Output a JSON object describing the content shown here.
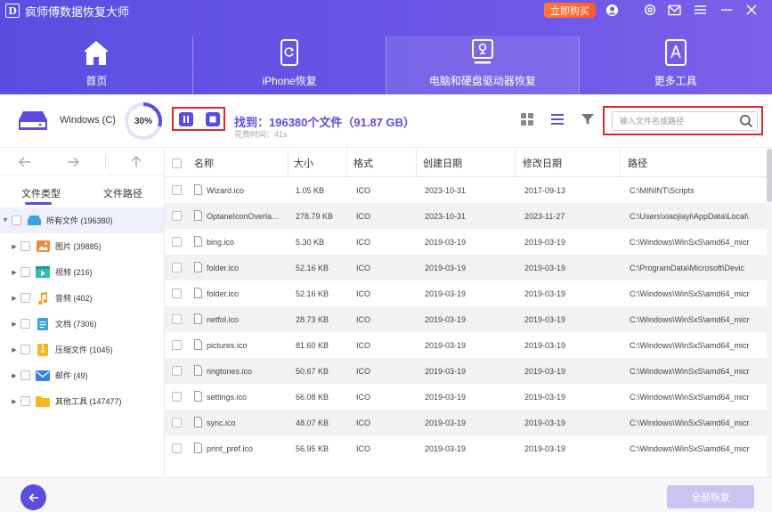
{
  "app": {
    "title": "疯师傅数据恢复大师",
    "logo_letter": "D",
    "buy_label": "立即购买"
  },
  "nav": [
    {
      "label": "首页",
      "icon": "home-icon"
    },
    {
      "label": "iPhone恢复",
      "icon": "phone-icon"
    },
    {
      "label": "电脑和硬盘驱动器恢复",
      "icon": "computer-icon",
      "active": true
    },
    {
      "label": "更多工具",
      "icon": "tools-icon"
    }
  ],
  "scan": {
    "drive_label": "Windows (C)",
    "progress_text": "30%",
    "progress_value": 0.3,
    "found_text": "找到：196380个文件（91.87 GB）",
    "elapsed_text": "花费时间：41s"
  },
  "search": {
    "placeholder": "输入文件名或路径",
    "value": ""
  },
  "sidebar": {
    "tabs": [
      "文件类型",
      "文件路径"
    ],
    "root": {
      "label": "所有文件 (196380)"
    },
    "categories": [
      {
        "label": "图片 (39885)",
        "icon": "image-icon",
        "color": "#f08a3c"
      },
      {
        "label": "视频 (216)",
        "icon": "video-icon",
        "color": "#2ebfb0"
      },
      {
        "label": "音频 (402)",
        "icon": "audio-icon",
        "color": "#f0a020"
      },
      {
        "label": "文档 (7306)",
        "icon": "document-icon",
        "color": "#3aa0e8"
      },
      {
        "label": "压缩文件 (1045)",
        "icon": "archive-icon",
        "color": "#f5b820"
      },
      {
        "label": "邮件 (49)",
        "icon": "mail-icon",
        "color": "#3a7ee8"
      },
      {
        "label": "其他工具 (147477)",
        "icon": "folder-icon",
        "color": "#f5b820"
      }
    ]
  },
  "table": {
    "columns": [
      "名称",
      "大小",
      "格式",
      "创建日期",
      "修改日期",
      "路径"
    ],
    "rows": [
      [
        "Wizard.ico",
        "1.05 KB",
        "ICO",
        "2023-10-31",
        "2017-09-13",
        "C:\\MININT\\Scripts"
      ],
      [
        "OptaneIconOverla...",
        "278.79 KB",
        "ICO",
        "2023-10-31",
        "2023-11-27",
        "C:\\Users\\xiaojiayi\\AppData\\Local\\"
      ],
      [
        "bing.ico",
        "5.30 KB",
        "ICO",
        "2019-03-19",
        "2019-03-19",
        "C:\\Windows\\WinSxS\\amd64_micr"
      ],
      [
        "folder.ico",
        "52.16 KB",
        "ICO",
        "2019-03-19",
        "2019-03-19",
        "C:\\ProgramData\\Microsoft\\Devic"
      ],
      [
        "folder.ico",
        "52.16 KB",
        "ICO",
        "2019-03-19",
        "2019-03-19",
        "C:\\Windows\\WinSxS\\amd64_micr"
      ],
      [
        "netfol.ico",
        "28.73 KB",
        "ICO",
        "2019-03-19",
        "2019-03-19",
        "C:\\Windows\\WinSxS\\amd64_micr"
      ],
      [
        "pictures.ico",
        "81.60 KB",
        "ICO",
        "2019-03-19",
        "2019-03-19",
        "C:\\Windows\\WinSxS\\amd64_micr"
      ],
      [
        "ringtones.ico",
        "50.67 KB",
        "ICO",
        "2019-03-19",
        "2019-03-19",
        "C:\\Windows\\WinSxS\\amd64_micr"
      ],
      [
        "settings.ico",
        "66.08 KB",
        "ICO",
        "2019-03-19",
        "2019-03-19",
        "C:\\Windows\\WinSxS\\amd64_micr"
      ],
      [
        "sync.ico",
        "48.07 KB",
        "ICO",
        "2019-03-19",
        "2019-03-19",
        "C:\\Windows\\WinSxS\\amd64_micr"
      ],
      [
        "print_pref.ico",
        "56.95 KB",
        "ICO",
        "2019-03-19",
        "2019-03-19",
        "C:\\Windows\\WinSxS\\amd64_micr"
      ]
    ]
  },
  "footer": {
    "recover_label": "全部恢复"
  },
  "colors": {
    "accent": "#5a4ee0",
    "highlight": "#e0262b",
    "buy": "#ff6a33"
  }
}
